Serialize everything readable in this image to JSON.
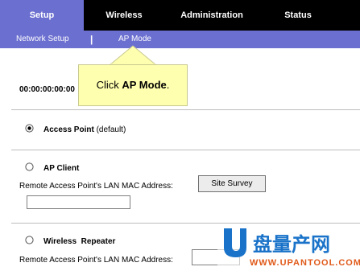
{
  "nav": {
    "tabs": [
      {
        "label": "Setup"
      },
      {
        "label": "Wireless"
      },
      {
        "label": "Administration"
      },
      {
        "label": "Status"
      }
    ]
  },
  "subnav": {
    "items": [
      {
        "label": "Network Setup"
      },
      {
        "label": "AP Mode"
      }
    ],
    "separator": "|"
  },
  "callout": {
    "prefix": "Click ",
    "bold": "AP Mode",
    "suffix": "."
  },
  "device_mac": "00:00:00:00:00",
  "modes": {
    "access_point": {
      "label": "Access Point",
      "note": "(default)",
      "selected": true
    },
    "ap_client": {
      "label": "AP Client",
      "selected": false
    },
    "wireless_repeater": {
      "label": "Wireless  Repeater",
      "selected": false
    }
  },
  "remote_mac_label": "Remote Access Point's LAN MAC Address:",
  "site_survey_label": "Site Survey",
  "remote_mac_value": "",
  "watermark": {
    "cn": "盘量产网",
    "url": "WWW.UPANTOOL.COM"
  },
  "colors": {
    "nav_bg": "#000000",
    "accent": "#6b6fd0",
    "callout_bg": "#ffffb0"
  }
}
